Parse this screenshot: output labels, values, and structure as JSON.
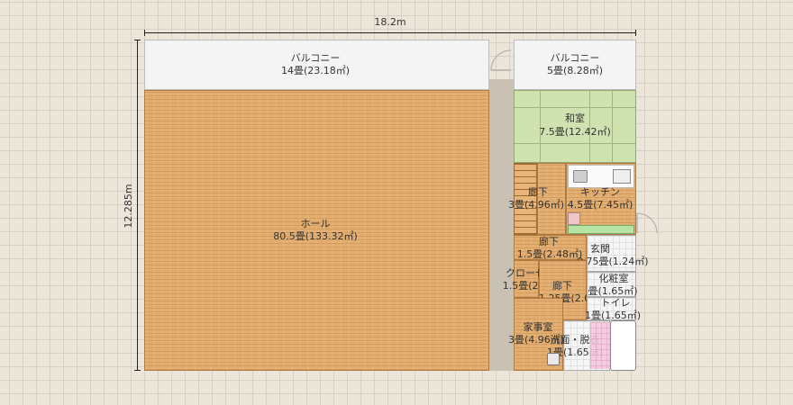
{
  "dimensions": {
    "width": "18.2m",
    "height": "12.285m"
  },
  "rooms": {
    "balcony_large": {
      "name": "バルコニー",
      "area": "14畳(23.18㎡)"
    },
    "hall": {
      "name": "ホール",
      "area": "80.5畳(133.32㎡)"
    },
    "balcony_small": {
      "name": "バルコニー",
      "area": "5畳(8.28㎡)"
    },
    "washitsu": {
      "name": "和室",
      "area": "7.5畳(12.42㎡)"
    },
    "hallway_upper": {
      "name": "廊下",
      "area": "3畳(4.96㎡)"
    },
    "kitchen": {
      "name": "キッチン",
      "area": "4.5畳(7.45㎡)"
    },
    "hallway_mid": {
      "name": "廊下",
      "area": "1.5畳(2.48㎡)"
    },
    "genkan": {
      "name": "玄関",
      "area": "0.75畳(1.24㎡)"
    },
    "closet": {
      "name": "クローゼット",
      "area": "1.5畳(2.48㎡)"
    },
    "hallway_small": {
      "name": "廊下",
      "area": "1.25畳(2.07㎡)"
    },
    "powder_room": {
      "name": "化粧室",
      "area": "畳(1.65㎡)"
    },
    "toilet": {
      "name": "トイレ",
      "area": "1畳(1.65㎡)"
    },
    "utility": {
      "name": "家事室",
      "area": "3畳(4.96㎡)"
    },
    "washroom": {
      "name": "洗面・脱衣",
      "area": "1畳(1.65㎡)"
    }
  },
  "colors": {
    "wood": "#e3ad6f",
    "tatami": "#cfe2b0",
    "balcony": "#f4f4f4",
    "wall": "#c9c2b4"
  }
}
